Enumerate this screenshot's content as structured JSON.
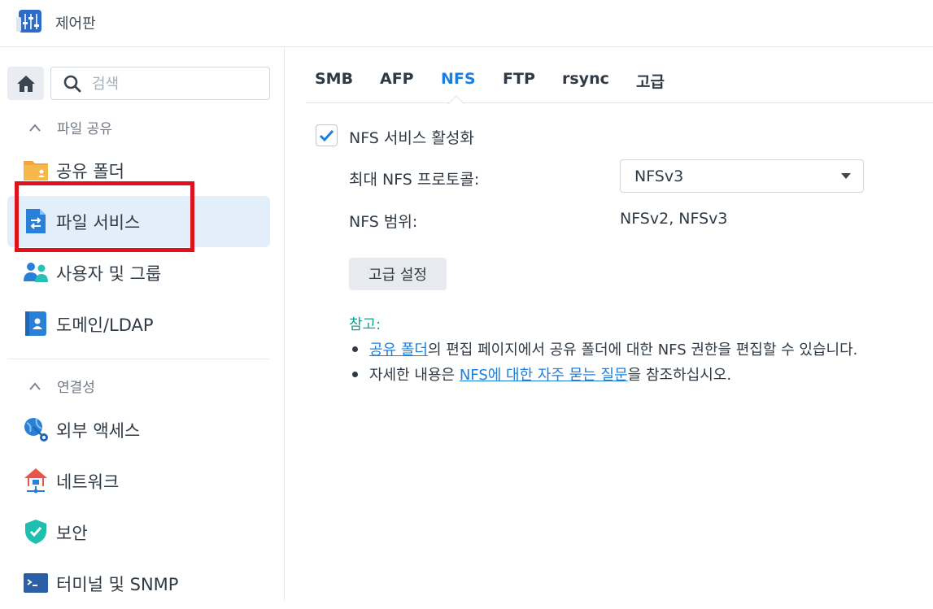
{
  "window": {
    "title": "제어판"
  },
  "sidebar": {
    "search_placeholder": "검색",
    "sections": [
      {
        "label": "파일 공유"
      },
      {
        "label": "연결성"
      }
    ],
    "items": [
      {
        "label": "공유 폴더",
        "icon": "shared-folder-icon"
      },
      {
        "label": "파일 서비스",
        "icon": "file-services-icon",
        "active": true
      },
      {
        "label": "사용자 및 그룹",
        "icon": "users-groups-icon"
      },
      {
        "label": "도메인/LDAP",
        "icon": "domain-ldap-icon"
      },
      {
        "label": "외부 액세스",
        "icon": "external-access-icon"
      },
      {
        "label": "네트워크",
        "icon": "network-icon"
      },
      {
        "label": "보안",
        "icon": "security-shield-icon"
      },
      {
        "label": "터미널 및 SNMP",
        "icon": "terminal-icon"
      }
    ]
  },
  "tabs": [
    {
      "label": "SMB"
    },
    {
      "label": "AFP"
    },
    {
      "label": "NFS",
      "active": true
    },
    {
      "label": "FTP"
    },
    {
      "label": "rsync"
    },
    {
      "label": "고급"
    }
  ],
  "nfs": {
    "enable_label": "NFS 서비스 활성화",
    "enabled": true,
    "max_protocol_label": "최대 NFS 프로토콜:",
    "max_protocol_value": "NFSv3",
    "range_label": "NFS 범위:",
    "range_value": "NFSv2, NFSv3",
    "advanced_button": "고급 설정"
  },
  "note": {
    "title": "참고:",
    "line1_link": "공유 폴더",
    "line1_text": "의 편집 페이지에서 공유 폴더에 대한 NFS 권한을 편집할 수 있습니다.",
    "line2_prefix": "자세한 내용은 ",
    "line2_link": "NFS에 대한 자주 묻는 질문",
    "line2_suffix": "을 참조하십시오."
  },
  "colors": {
    "accent": "#1b7fe0",
    "active_bg": "#e3eefb",
    "note_title": "#18a08e",
    "highlight": "#e0101c"
  }
}
